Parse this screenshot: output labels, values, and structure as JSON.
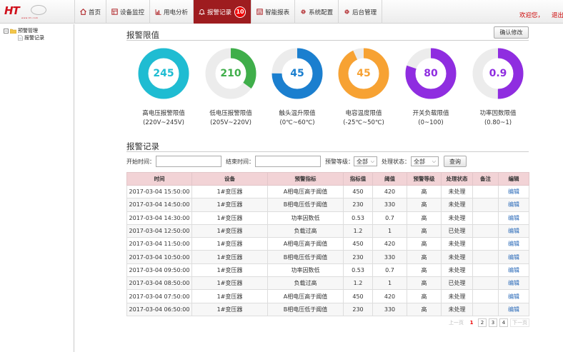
{
  "app": {
    "logo_text": "HT",
    "logo_sub": "www.ht.com"
  },
  "nav": {
    "items": [
      {
        "label": "首页",
        "icon": "home-icon"
      },
      {
        "label": "设备监控",
        "icon": "grid-icon"
      },
      {
        "label": "用电分析",
        "icon": "bar-chart-icon"
      },
      {
        "label": "报警记录",
        "icon": "bell-icon",
        "badge": "10",
        "active": true
      },
      {
        "label": "智能报表",
        "icon": "report-icon"
      },
      {
        "label": "系统配置",
        "icon": "gear-icon"
      },
      {
        "label": "后台管理",
        "icon": "gear-icon"
      }
    ],
    "welcome": "欢迎您，",
    "logout": "退出"
  },
  "sidebar": {
    "root": {
      "toggle": "⊟",
      "label": "预警管理"
    },
    "child": {
      "label": "报警记录"
    }
  },
  "thresholds": {
    "title": "报警限值",
    "confirm_label": "确认修改",
    "gauges": [
      {
        "value": "245",
        "label": "高电压报警限值",
        "range": "(220V~245V)",
        "color": "#1fbcd2",
        "fraction": 1.0
      },
      {
        "value": "210",
        "label": "低电压报警限值",
        "range": "(205V~220V)",
        "color": "#3fae4a",
        "fraction": 0.35
      },
      {
        "value": "45",
        "label": "触头温升限值",
        "range": "(0℃~60℃)",
        "color": "#1b7fcf",
        "fraction": 0.75
      },
      {
        "value": "45",
        "label": "电容温度限值",
        "range": "(-25℃~50℃)",
        "color": "#f7a233",
        "fraction": 0.93
      },
      {
        "value": "80",
        "label": "开关负载限值",
        "range": "(0~100)",
        "color": "#8f2de0",
        "fraction": 0.8
      },
      {
        "value": "0.9",
        "label": "功率因数限值",
        "range": "(0.80~1)",
        "color": "#8f2de0",
        "fraction": 0.5
      }
    ],
    "track_color": "#ececec"
  },
  "records": {
    "title": "报警记录",
    "filters": {
      "start_label": "开始时间：",
      "end_label": "结束时间：",
      "level_label": "预警等级：",
      "level_value": "全部",
      "status_label": "处理状态：",
      "status_value": "全部",
      "query_label": "查询"
    },
    "columns": [
      "时间",
      "设备",
      "预警指标",
      "指标值",
      "阈值",
      "预警等级",
      "处理状态",
      "备注",
      "编辑"
    ],
    "rows": [
      [
        "2017-03-04 15:50:00",
        "1#变压器",
        "A相电压高于阈值",
        "450",
        "420",
        "高",
        "未处理",
        "",
        "编辑"
      ],
      [
        "2017-03-04 14:50:00",
        "1#变压器",
        "B相电压低于阈值",
        "230",
        "330",
        "高",
        "未处理",
        "",
        "编辑"
      ],
      [
        "2017-03-04 14:30:00",
        "1#变压器",
        "功率因数低",
        "0.53",
        "0.7",
        "高",
        "未处理",
        "",
        "编辑"
      ],
      [
        "2017-03-04 12:50:00",
        "1#变压器",
        "负载过高",
        "1.2",
        "1",
        "高",
        "已处理",
        "",
        "编辑"
      ],
      [
        "2017-03-04 11:50:00",
        "1#变压器",
        "A相电压高于阈值",
        "450",
        "420",
        "高",
        "未处理",
        "",
        "编辑"
      ],
      [
        "2017-03-04 10:50:00",
        "1#变压器",
        "B相电压低于阈值",
        "230",
        "330",
        "高",
        "未处理",
        "",
        "编辑"
      ],
      [
        "2017-03-04 09:50:00",
        "1#变压器",
        "功率因数低",
        "0.53",
        "0.7",
        "高",
        "未处理",
        "",
        "编辑"
      ],
      [
        "2017-03-04 08:50:00",
        "1#变压器",
        "负载过高",
        "1.2",
        "1",
        "高",
        "已处理",
        "",
        "编辑"
      ],
      [
        "2017-03-04 07:50:00",
        "1#变压器",
        "A相电压高于阈值",
        "450",
        "420",
        "高",
        "未处理",
        "",
        "编辑"
      ],
      [
        "2017-03-04 06:50:00",
        "1#变压器",
        "B相电压低于阈值",
        "230",
        "330",
        "高",
        "未处理",
        "",
        "编辑"
      ]
    ],
    "pager": {
      "prev": "上一页",
      "pages": [
        "1",
        "2",
        "3",
        "4"
      ],
      "current": "1",
      "next": "下一页"
    }
  }
}
